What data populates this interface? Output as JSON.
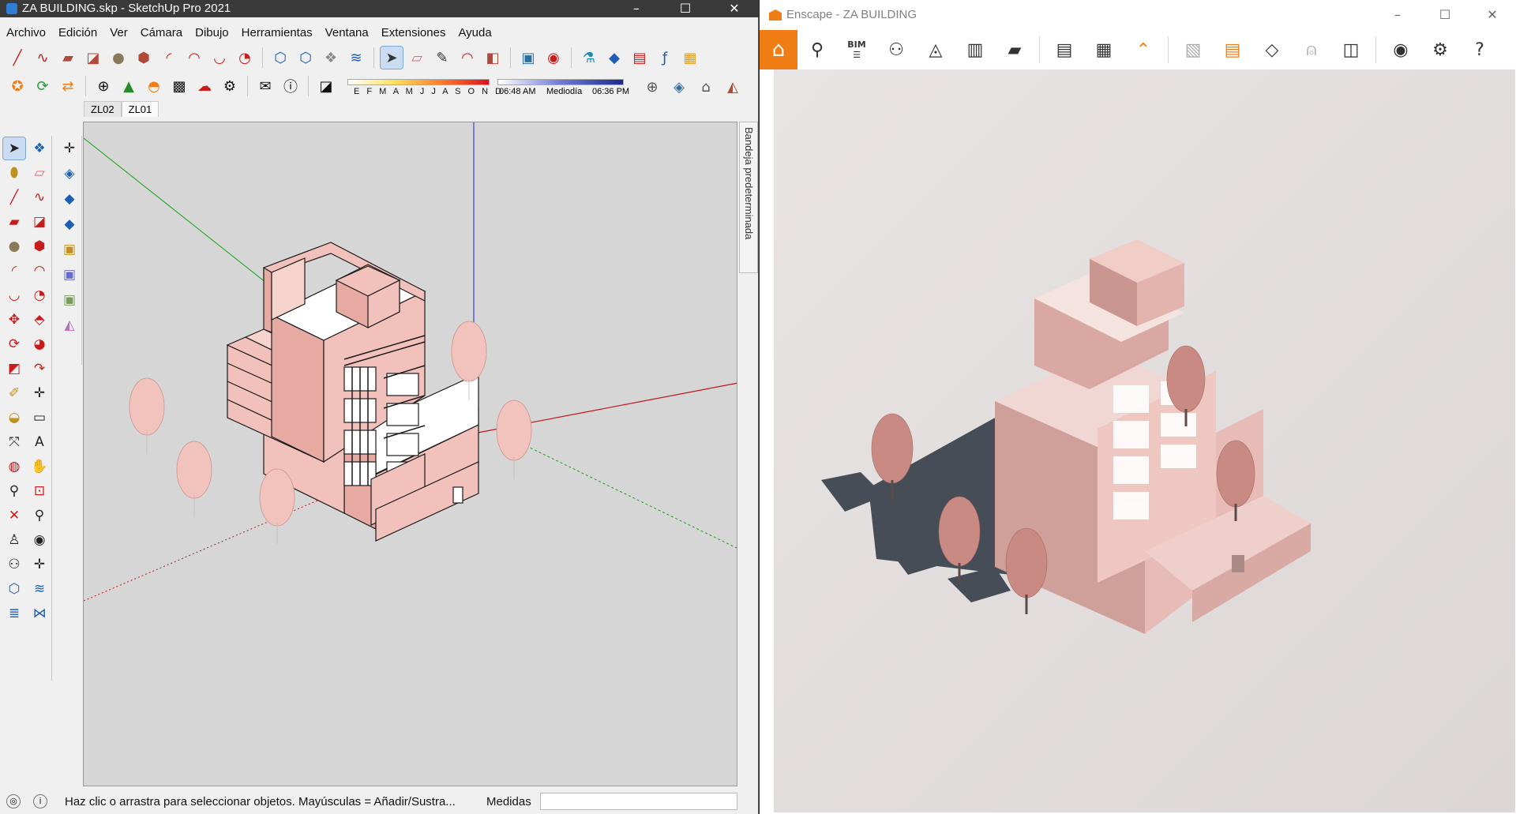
{
  "sketchup": {
    "title": "ZA BUILDING.skp - SketchUp Pro 2021",
    "window_controls": [
      "–",
      "☐",
      "✕"
    ],
    "menu": [
      "Archivo",
      "Edición",
      "Ver",
      "Cámara",
      "Dibujo",
      "Herramientas",
      "Ventana",
      "Extensiones",
      "Ayuda"
    ],
    "shadow": {
      "months": "E F M A M J J A S O N D",
      "time_start": "06:48 AM",
      "time_mid": "Mediodía",
      "time_end": "06:36 PM"
    },
    "scene_tabs": [
      "ZL02",
      "ZL01"
    ],
    "active_scene": "ZL01",
    "tray_label": "Bandeja predeterminada",
    "status_message": "Haz clic o arrastra para seleccionar objetos. Mayúsculas = Añadir/Sustra...",
    "measures_label": "Medidas",
    "measures_value": ""
  },
  "enscape": {
    "title": "Enscape - ZA BUILDING",
    "window_controls": [
      "–",
      "☐",
      "✕"
    ],
    "bim_label": "BIM"
  },
  "colors": {
    "model_fill": "#f2c1bb",
    "model_edge": "#1a1a1a",
    "enscape_accent": "#f07e14",
    "axis_red": "#c01515",
    "axis_green": "#12a012",
    "axis_blue": "#3030c8"
  }
}
